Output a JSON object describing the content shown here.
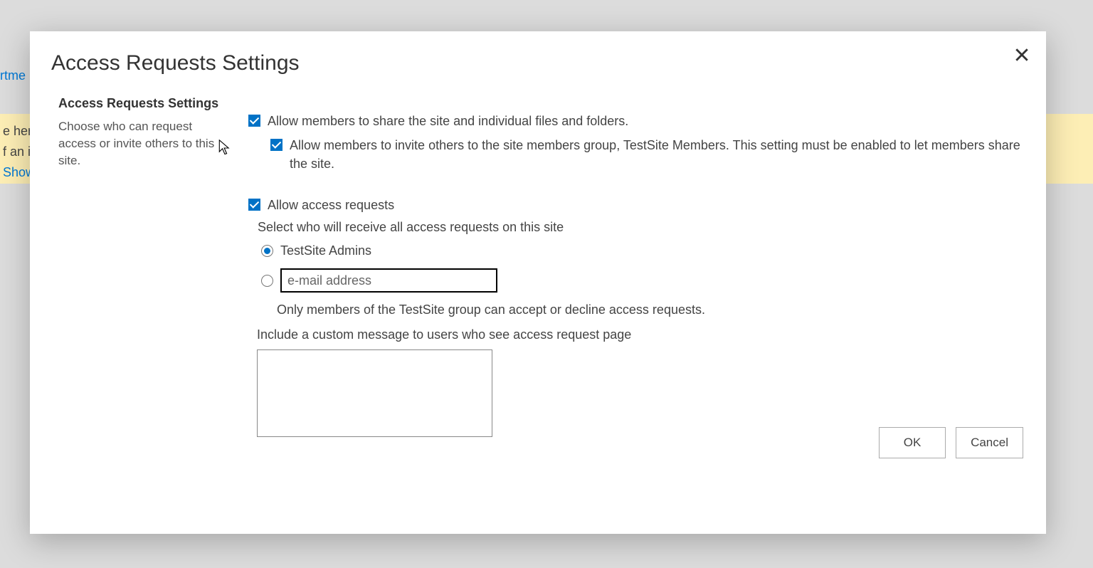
{
  "background": {
    "breadcrumb_fragment": "rtme",
    "banner_line1": "e her",
    "banner_line2": "f an it",
    "banner_show": "Show"
  },
  "dialog": {
    "title": "Access Requests Settings",
    "close_label": "✕"
  },
  "sidebar": {
    "heading": "Access Requests Settings",
    "description": "Choose who can request access or invite others to this site."
  },
  "settings": {
    "allow_share_label": "Allow members to share the site and individual files and folders.",
    "allow_share_checked": true,
    "allow_invite_label": "Allow members to invite others to the site members group, TestSite Members. This setting must be enabled to let members share the site.",
    "allow_invite_checked": true,
    "allow_requests_label": "Allow access requests",
    "allow_requests_checked": true,
    "recipient_instruction": "Select who will receive all access requests on this site",
    "radio_admins_label": "TestSite Admins",
    "radio_selected": "admins",
    "email_placeholder": "e-mail address",
    "email_value": "",
    "accept_note": "Only members of the TestSite group can accept or decline access requests.",
    "custom_msg_label": "Include a custom message to users who see access request page",
    "custom_msg_value": ""
  },
  "footer": {
    "ok_label": "OK",
    "cancel_label": "Cancel"
  }
}
